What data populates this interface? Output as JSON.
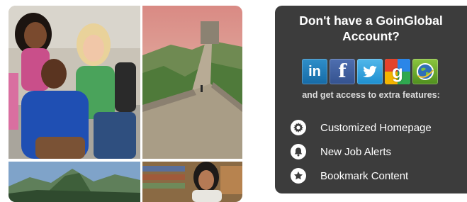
{
  "collage": {
    "photos": [
      {
        "subject": "students-photo"
      },
      {
        "subject": "great-wall-photo"
      },
      {
        "subject": "mountain-photo"
      },
      {
        "subject": "library-photo"
      }
    ]
  },
  "panel": {
    "title": "Don't have a GoinGlobal Account?",
    "social_buttons": [
      {
        "icon": "linkedin-icon",
        "glyph": "in",
        "color": "#1f7bbd"
      },
      {
        "icon": "facebook-icon",
        "glyph": "f",
        "color": "#3b5998"
      },
      {
        "icon": "twitter-icon",
        "glyph": "",
        "color": "#2aa3e3"
      },
      {
        "icon": "google-icon",
        "glyph": "g",
        "color": "#e4432c"
      },
      {
        "icon": "goinglobal-icon",
        "glyph": "",
        "color": "#6aab2e"
      }
    ],
    "tagline": "and get access to extra features:",
    "features": [
      {
        "icon": "gear-icon",
        "label": "Customized Homepage"
      },
      {
        "icon": "bell-icon",
        "label": "New Job Alerts"
      },
      {
        "icon": "star-icon",
        "label": "Bookmark Content"
      }
    ]
  },
  "colors": {
    "panel_bg": "#3c3c3c",
    "panel_text": "#ffffff"
  }
}
